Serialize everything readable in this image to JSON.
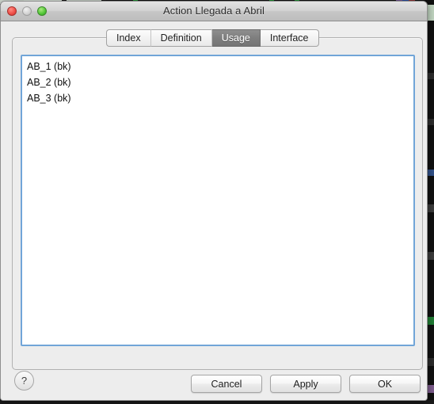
{
  "window": {
    "title": "Action Llegada a Abril",
    "controls": {
      "close": "close-button",
      "minimize": "minimize-button",
      "zoom": "zoom-button"
    }
  },
  "tabs": [
    {
      "label": "Index",
      "selected": false
    },
    {
      "label": "Definition",
      "selected": false
    },
    {
      "label": "Usage",
      "selected": true
    },
    {
      "label": "Interface",
      "selected": false
    }
  ],
  "usage_list": {
    "items": [
      "AB_1 (bk)",
      "AB_2 (bk)",
      "AB_3 (bk)"
    ]
  },
  "footer": {
    "help_label": "?",
    "buttons": [
      {
        "label": "Cancel"
      },
      {
        "label": "Apply"
      },
      {
        "label": "OK"
      }
    ]
  },
  "colors": {
    "window_bg": "#ededed",
    "titlebar_top": "#e4e4e4",
    "titlebar_bottom": "#bdbdbd",
    "tab_selected_bg": "#7e7e7e",
    "tab_selected_text": "#ffffff",
    "list_focus_border": "#71a5d8",
    "list_bg": "#ffffff",
    "close_light": "#f0514a",
    "minimize_light": "#d2d2d2",
    "zoom_light": "#56c93a"
  }
}
